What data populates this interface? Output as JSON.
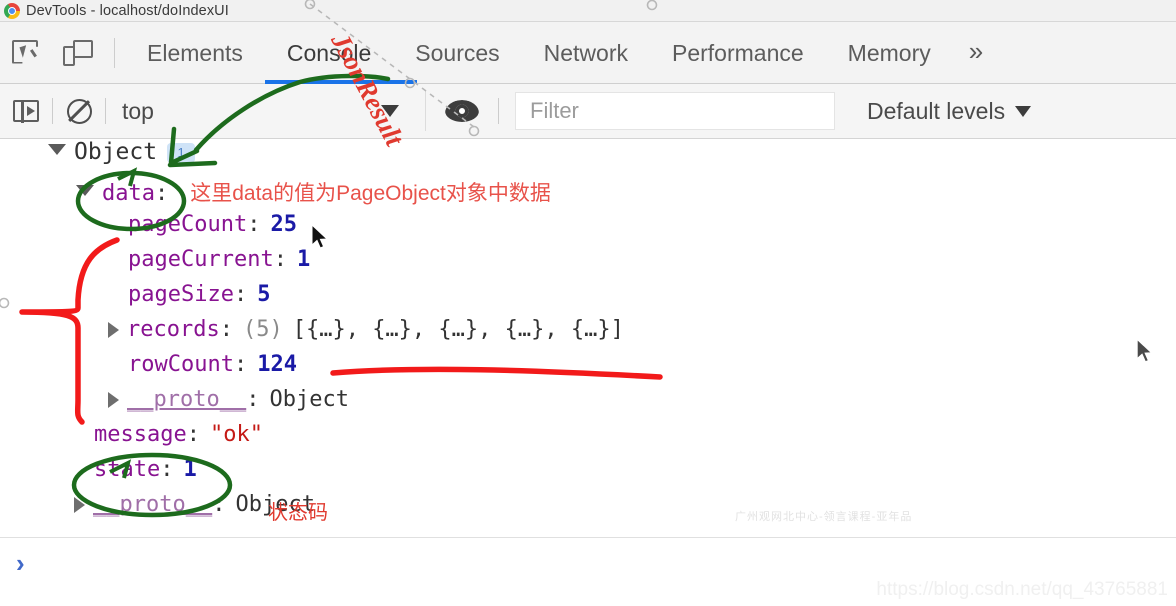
{
  "window": {
    "title": "DevTools - localhost/doIndexUI",
    "logo_icon": "chrome-logo-icon"
  },
  "tabstrip": {
    "inspect_icon": "inspect-element-icon",
    "device_icon": "device-toolbar-icon",
    "tabs": [
      {
        "label": "Elements",
        "active": false
      },
      {
        "label": "Console",
        "active": true
      },
      {
        "label": "Sources",
        "active": false
      },
      {
        "label": "Network",
        "active": false
      },
      {
        "label": "Performance",
        "active": false
      },
      {
        "label": "Memory",
        "active": false
      }
    ],
    "more_label": "»",
    "active_underline_color": "#1a73e8"
  },
  "console_toolbar": {
    "sidebar_icon": "console-sidebar-icon",
    "clear_icon": "clear-console-icon",
    "context": {
      "value": "top",
      "caret_icon": "chevron-down-icon"
    },
    "eye_icon": "live-expression-eye-icon",
    "filter": {
      "value": "",
      "placeholder": "Filter"
    },
    "levels": {
      "label": "Default levels",
      "caret_icon": "chevron-down-icon"
    }
  },
  "console_log": {
    "root": {
      "toggle_icon": "triangle-down-icon",
      "label": "Object",
      "badge": "1"
    },
    "rows": [
      {
        "indent": 1,
        "toggle": "triangle-down-icon",
        "key": "data",
        "sep": ":",
        "value": "",
        "value_type": "none",
        "note": "这里data的值为PageObject对象中数据"
      },
      {
        "indent": 2,
        "toggle": "none",
        "key": "pageCount",
        "sep": ":",
        "value": "25",
        "value_type": "number"
      },
      {
        "indent": 2,
        "toggle": "none",
        "key": "pageCurrent",
        "sep": ":",
        "value": "1",
        "value_type": "number"
      },
      {
        "indent": 2,
        "toggle": "none",
        "key": "pageSize",
        "sep": ":",
        "value": "5",
        "value_type": "number"
      },
      {
        "indent": 2,
        "toggle": "triangle-right-icon",
        "key": "records",
        "sep": ":",
        "value_count": "(5)",
        "value": "[{…}, {…}, {…}, {…}, {…}]",
        "value_type": "array"
      },
      {
        "indent": 2,
        "toggle": "none",
        "key": "rowCount",
        "sep": ":",
        "value": "124",
        "value_type": "number"
      },
      {
        "indent": 2,
        "toggle": "triangle-right-icon",
        "key": "__proto__",
        "sep": ":",
        "value": "Object",
        "value_type": "proto"
      },
      {
        "indent": 1,
        "toggle": "none",
        "key": "message",
        "sep": ":",
        "value": "\"ok\"",
        "value_type": "string"
      },
      {
        "indent": 1,
        "toggle": "none",
        "key": "state",
        "sep": ":",
        "value": "1",
        "value_type": "number"
      },
      {
        "indent": 1,
        "toggle": "triangle-right-icon",
        "key": "__proto__",
        "sep": ":",
        "value": "Object",
        "value_type": "proto"
      }
    ]
  },
  "prompt": {
    "chevron": "›"
  },
  "annotations": {
    "jsonresult_label": "JsonResult",
    "statuscode_label": "状态码",
    "red_color": "#e03a2f",
    "green_color": "#1d6b1d",
    "red_ink_color": "#f21a1a"
  },
  "watermarks": {
    "chinese": "广州观网北中心-领言课程-亚年品",
    "url": "https://blog.csdn.net/qq_43765881"
  }
}
